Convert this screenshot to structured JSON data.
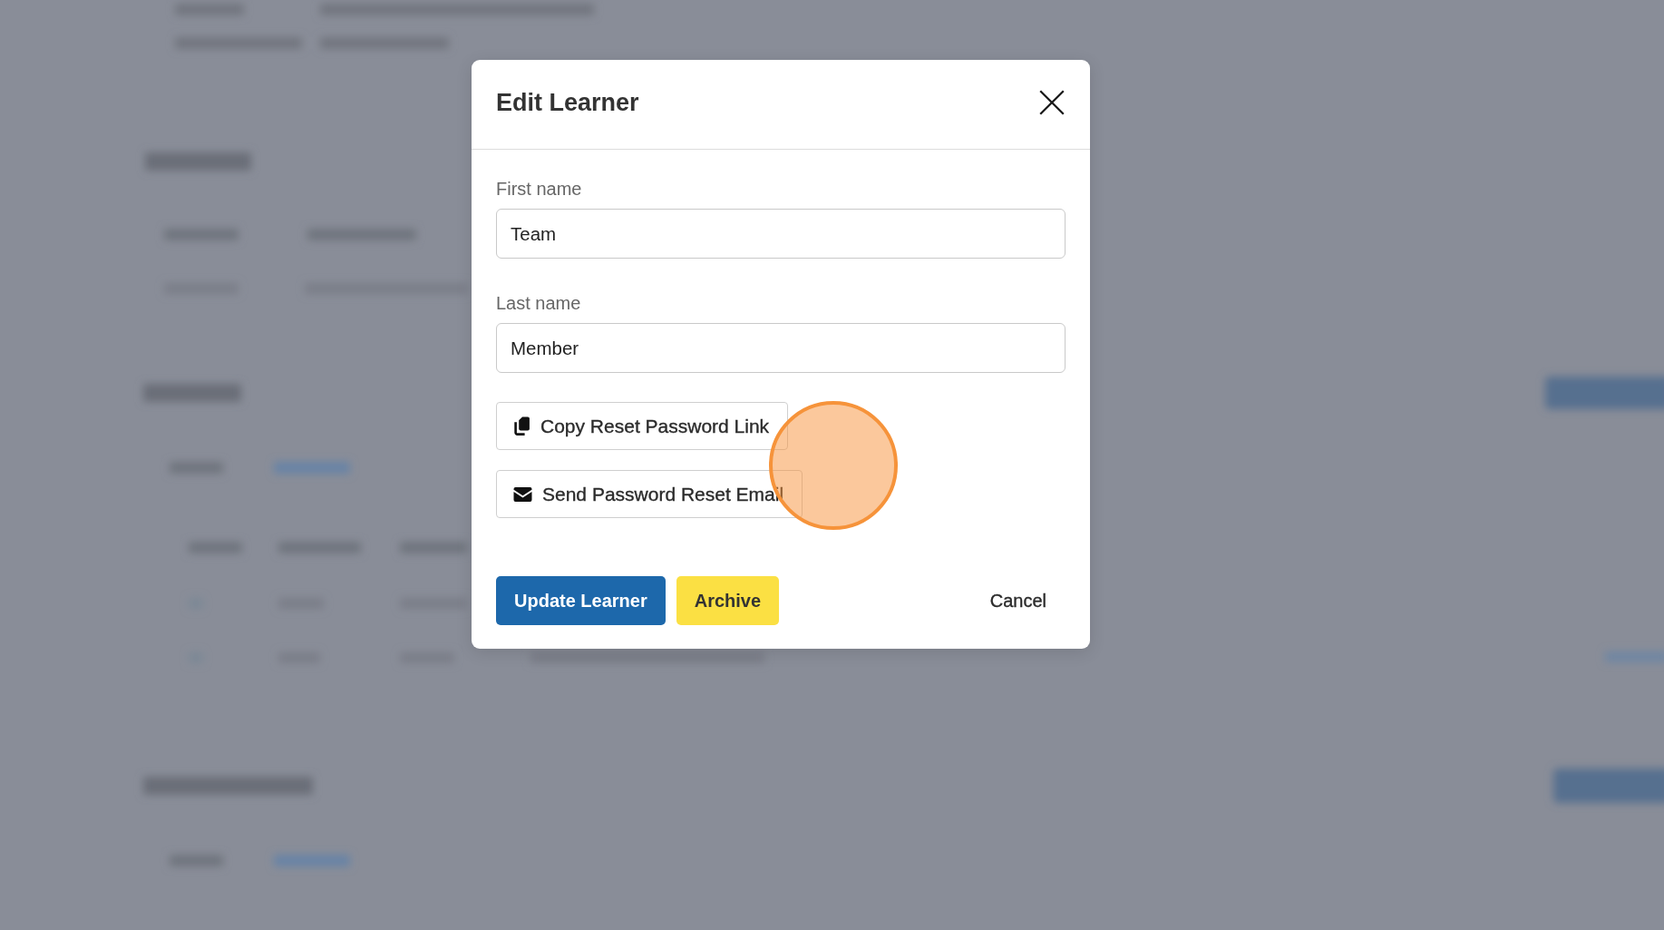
{
  "modal": {
    "title": "Edit Learner",
    "fields": [
      {
        "label": "First name",
        "value": "Team"
      },
      {
        "label": "Last name",
        "value": "Member"
      }
    ],
    "actions": [
      {
        "kind": "copy",
        "label": "Copy Reset Password Link"
      },
      {
        "kind": "email",
        "label": "Send Password Reset Email"
      }
    ],
    "footer_buttons": [
      {
        "kind": "primary",
        "label": "Update Learner"
      },
      {
        "kind": "warning",
        "label": "Archive"
      },
      {
        "kind": "cancel",
        "label": "Cancel"
      }
    ]
  }
}
